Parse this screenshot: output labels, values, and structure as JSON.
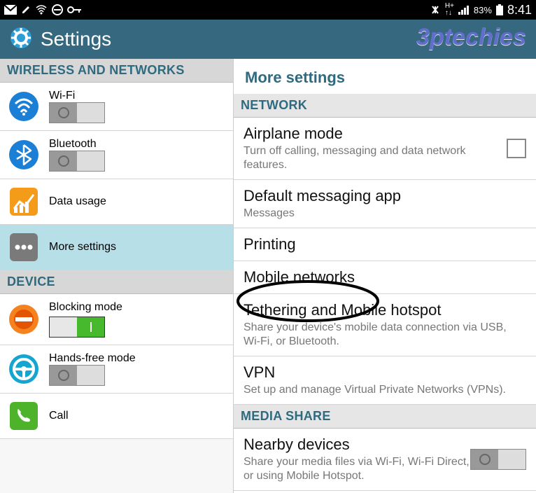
{
  "status": {
    "battery": "83%",
    "time": "8:41"
  },
  "app": {
    "title": "Settings",
    "watermark": "3ptechies"
  },
  "left": {
    "section1": "WIRELESS AND NETWORKS",
    "wifi": "Wi-Fi",
    "bluetooth": "Bluetooth",
    "data_usage": "Data usage",
    "more_settings": "More settings",
    "section2": "DEVICE",
    "blocking_mode": "Blocking mode",
    "hands_free": "Hands-free mode",
    "call": "Call"
  },
  "right": {
    "title": "More settings",
    "section_network": "NETWORK",
    "airplane": {
      "name": "Airplane mode",
      "desc": "Turn off calling, messaging and data network features."
    },
    "default_msg": {
      "name": "Default messaging app",
      "desc": "Messages"
    },
    "printing": "Printing",
    "mobile_networks": "Mobile networks",
    "tethering": {
      "name": "Tethering and Mobile hotspot",
      "desc": "Share your device's mobile data connection via USB, Wi-Fi, or Bluetooth."
    },
    "vpn": {
      "name": "VPN",
      "desc": "Set up and manage Virtual Private Networks (VPNs)."
    },
    "section_media": "MEDIA SHARE",
    "nearby": {
      "name": "Nearby devices",
      "desc": "Share your media files via Wi-Fi, Wi-Fi Direct, or using Mobile Hotspot."
    }
  }
}
